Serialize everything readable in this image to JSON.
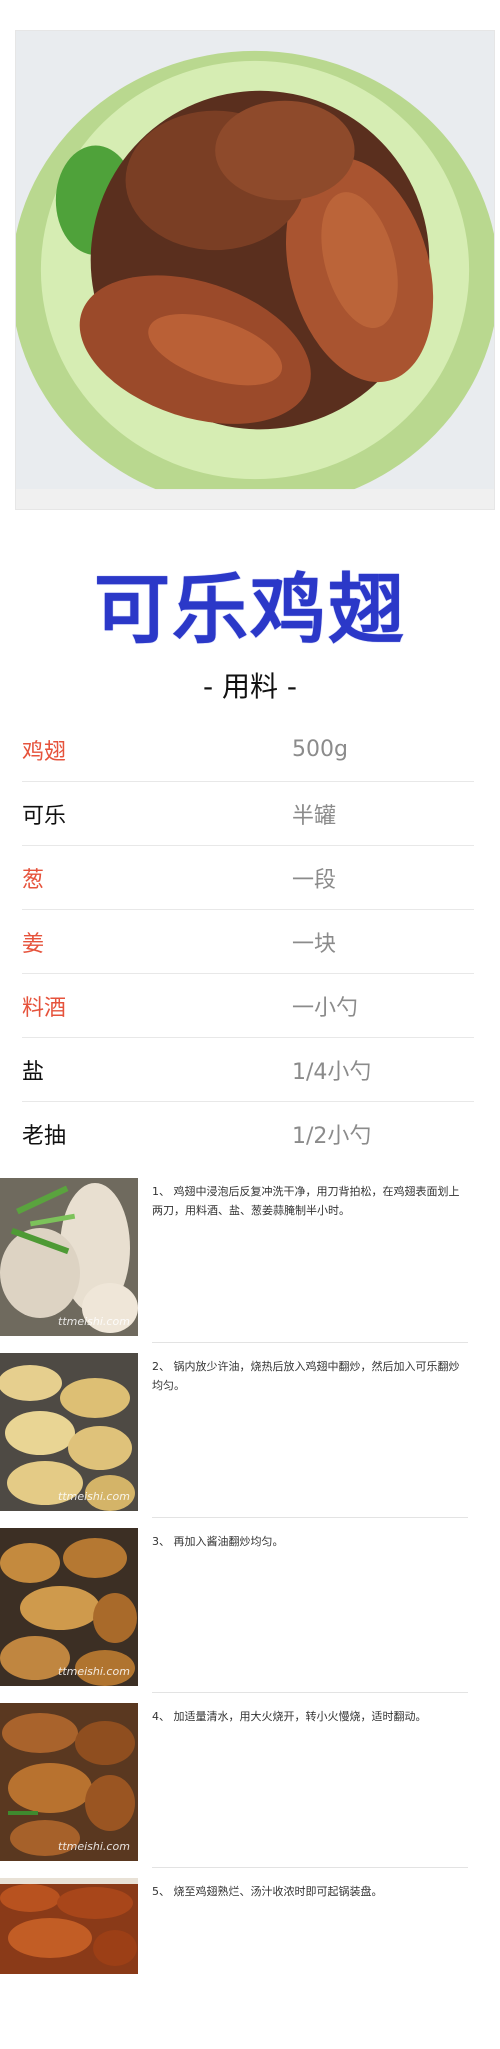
{
  "recipe": {
    "title": "可乐鸡翅",
    "ingredients_heading": "- 用料 -",
    "ingredients": [
      {
        "name": "鸡翅",
        "amount": "500g",
        "highlight": true
      },
      {
        "name": "可乐",
        "amount": "半罐",
        "highlight": false
      },
      {
        "name": "葱",
        "amount": "一段",
        "highlight": true
      },
      {
        "name": "姜",
        "amount": "一块",
        "highlight": true
      },
      {
        "name": "料酒",
        "amount": "一小勺",
        "highlight": true
      },
      {
        "name": "盐",
        "amount": "1/4小勺",
        "highlight": false
      },
      {
        "name": "老抽",
        "amount": "1/2小勺",
        "highlight": false
      }
    ],
    "steps": [
      {
        "text": "1、 鸡翅中浸泡后反复冲洗干净，用刀背拍松，在鸡翅表面划上两刀，用料酒、盐、葱姜蒜腌制半小时。"
      },
      {
        "text": "2、 锅内放少许油，烧热后放入鸡翅中翻炒，然后加入可乐翻炒均匀。"
      },
      {
        "text": "3、 再加入酱油翻炒均匀。"
      },
      {
        "text": "4、 加适量清水，用大火烧开，转小火慢烧，适时翻动。"
      },
      {
        "text": "5、 烧至鸡翅熟烂、汤汁收浓时即可起锅装盘。"
      }
    ],
    "watermark": "ttmeishi.com"
  },
  "colors": {
    "title": "#2b38c8",
    "highlight": "#e6533c",
    "amount": "#8b8b8b"
  }
}
